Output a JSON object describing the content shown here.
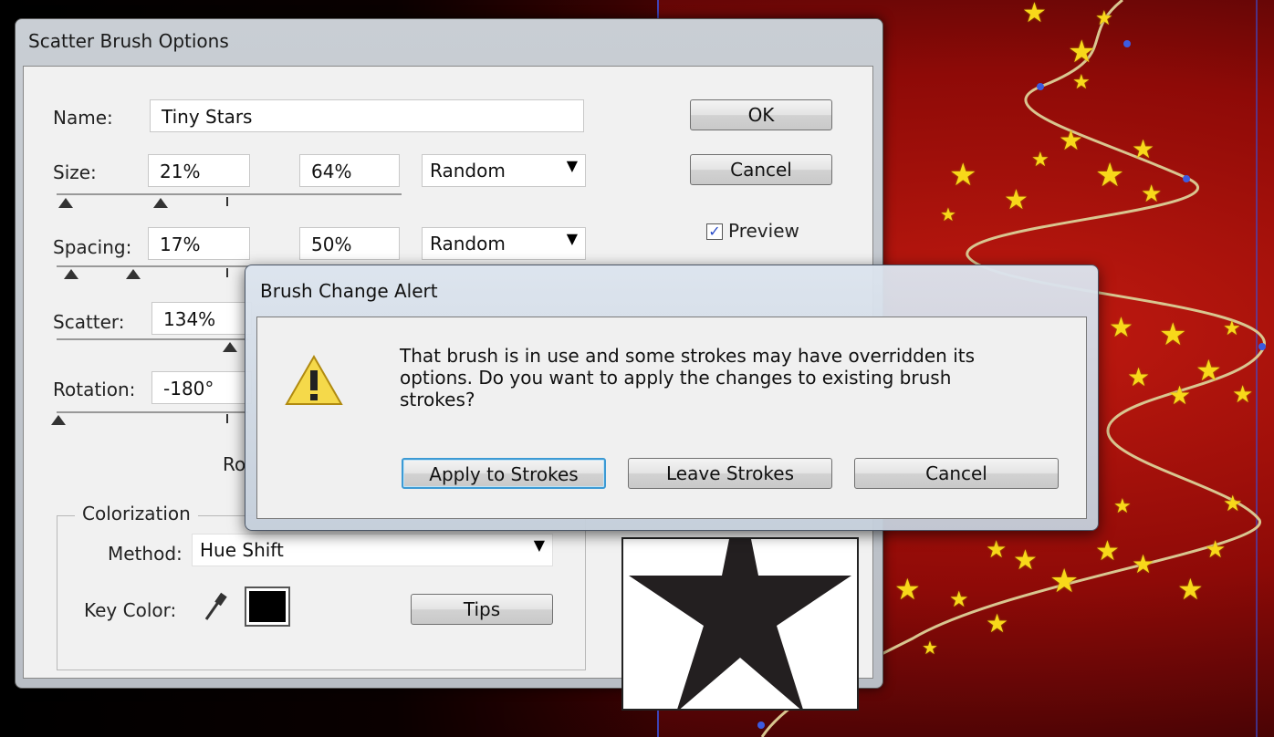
{
  "scatter_dialog": {
    "title": "Scatter Brush Options",
    "name_label": "Name:",
    "name_value": "Tiny Stars",
    "size_label": "Size:",
    "size_min": "21%",
    "size_max": "64%",
    "size_mode": "Random",
    "spacing_label": "Spacing:",
    "spacing_min": "17%",
    "spacing_max": "50%",
    "spacing_mode": "Random",
    "scatter_label": "Scatter:",
    "scatter_min": "134%",
    "rotation_label": "Rotation:",
    "rotation_min": "-180°",
    "rotation_relative_partial": "Ro",
    "ok_label": "OK",
    "cancel_label": "Cancel",
    "preview_label": "Preview",
    "preview_checked": true,
    "colorization_label": "Colorization",
    "method_label": "Method:",
    "method_value": "Hue Shift",
    "key_color_label": "Key Color:",
    "key_color_hex": "#000000",
    "tips_label": "Tips",
    "preview_glyph": "★"
  },
  "alert_dialog": {
    "title": "Brush Change Alert",
    "message": "That brush is in use and some strokes may have overridden its options. Do you want to apply the changes to existing brush strokes?",
    "apply_label": "Apply to Strokes",
    "leave_label": "Leave Strokes",
    "cancel_label": "Cancel",
    "icon": "warning-icon"
  },
  "colors": {
    "canvas_red": "#b3140c",
    "star_yellow": "#f8d81a",
    "guide_blue": "#3a4fd6",
    "default_button_border": "#3c9ad4"
  }
}
